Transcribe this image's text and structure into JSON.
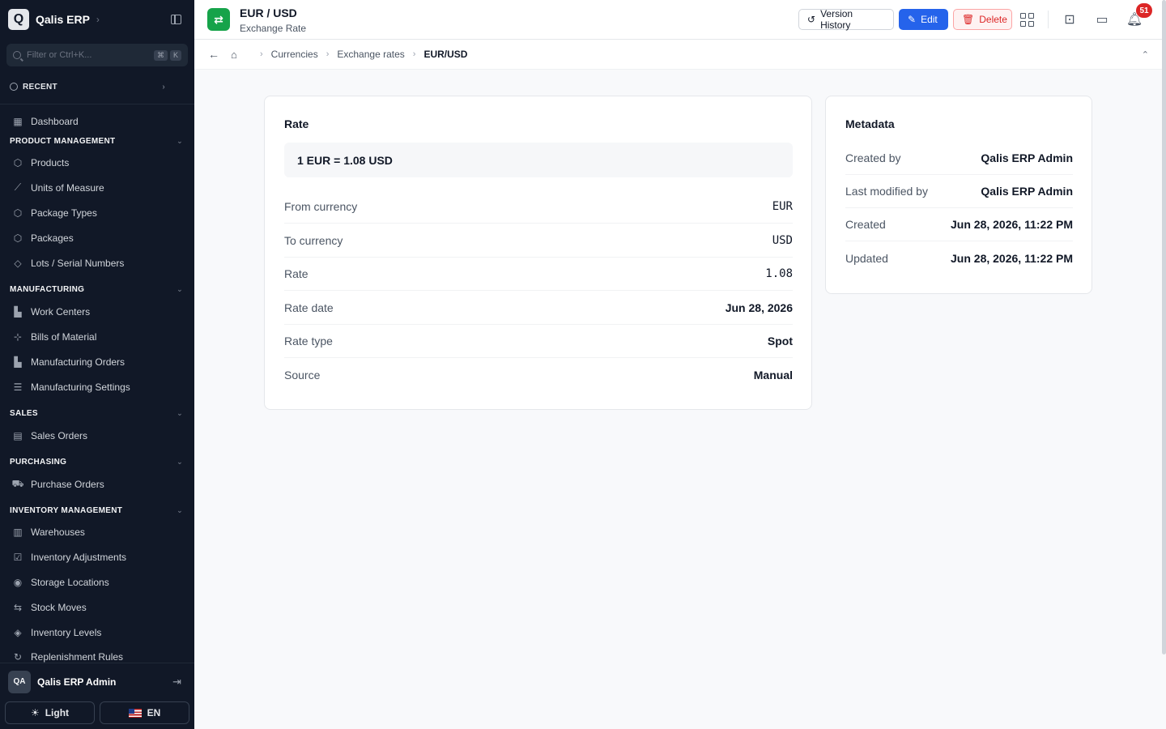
{
  "sidebar": {
    "logo_letter": "Q",
    "brand": "Qalis ERP",
    "filter_placeholder": "Filter or Ctrl+K...",
    "kbd": [
      "⌘",
      "K"
    ],
    "recent_label": "RECENT",
    "dashboard": "Dashboard",
    "sections": {
      "product": "PRODUCT MANAGEMENT",
      "manufacturing": "MANUFACTURING",
      "sales": "SALES",
      "purchasing": "PURCHASING",
      "inventory": "INVENTORY MANAGEMENT"
    },
    "items": {
      "products": "Products",
      "uom": "Units of Measure",
      "package_types": "Package Types",
      "packages": "Packages",
      "lots": "Lots / Serial Numbers",
      "work_centers": "Work Centers",
      "bom": "Bills of Material",
      "mfg_orders": "Manufacturing Orders",
      "mfg_settings": "Manufacturing Settings",
      "sales_orders": "Sales Orders",
      "purchase_orders": "Purchase Orders",
      "warehouses": "Warehouses",
      "inv_adjust": "Inventory Adjustments",
      "storage": "Storage Locations",
      "stock_moves": "Stock Moves",
      "inv_levels": "Inventory Levels",
      "replenishment": "Replenishment Rules"
    },
    "user": {
      "initials": "QA",
      "name": "Qalis ERP Admin"
    },
    "theme_label": "Light",
    "lang_label": "EN"
  },
  "topbar": {
    "title": "EUR / USD",
    "subtitle": "Exchange Rate",
    "version_history": "Version History",
    "edit": "Edit",
    "delete": "Delete",
    "notif_count": "51"
  },
  "breadcrumb": {
    "items": [
      "Currencies",
      "Exchange rates"
    ],
    "current": "EUR/USD"
  },
  "rate_card": {
    "title": "Rate",
    "summary": "1 EUR = 1.08 USD",
    "rows": [
      {
        "label": "From currency",
        "value": "EUR"
      },
      {
        "label": "To currency",
        "value": "USD"
      },
      {
        "label": "Rate",
        "value": "1.08"
      },
      {
        "label": "Rate date",
        "value": "Jun 28, 2026"
      },
      {
        "label": "Rate type",
        "value": "Spot"
      },
      {
        "label": "Source",
        "value": "Manual"
      }
    ]
  },
  "metadata": {
    "title": "Metadata",
    "rows": [
      {
        "label": "Created by",
        "value": "Qalis ERP Admin"
      },
      {
        "label": "Last modified by",
        "value": "Qalis ERP Admin"
      },
      {
        "label": "Created",
        "value": "Jun 28, 2026, 11:22 PM"
      },
      {
        "label": "Updated",
        "value": "Jun 28, 2026, 11:22 PM"
      }
    ]
  },
  "colors": {
    "accent": "#2563eb",
    "danger": "#dc2626",
    "brand_green": "#16a34a",
    "sidebar_bg": "#111827"
  }
}
